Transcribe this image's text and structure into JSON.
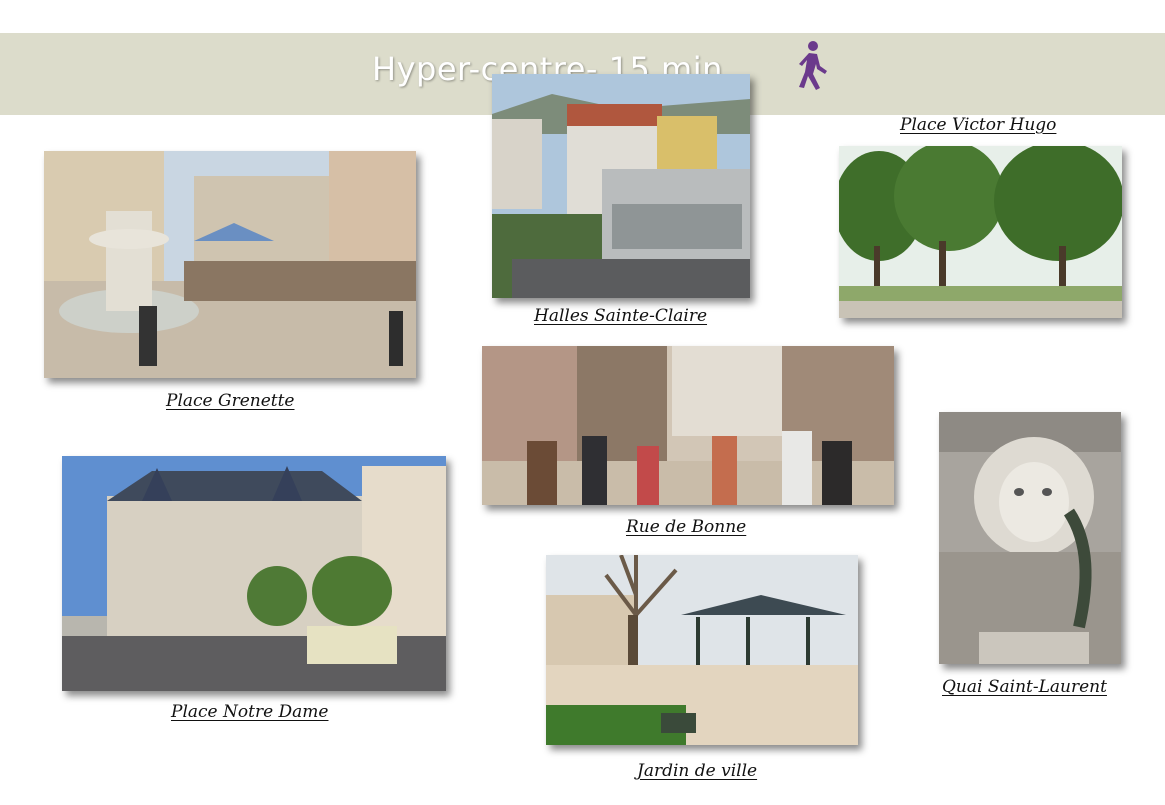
{
  "banner": {
    "title": "Hyper-centre- 15 min",
    "icon": "walking-person-icon",
    "icon_color": "#6b3a8c",
    "background": "#dcdccb"
  },
  "photos": [
    {
      "caption": "Place Grenette"
    },
    {
      "caption": "Halles Sainte-Claire"
    },
    {
      "caption": "Place Victor Hugo"
    },
    {
      "caption": "Rue de Bonne"
    },
    {
      "caption": "Place Notre Dame"
    },
    {
      "caption": "Jardin de ville"
    },
    {
      "caption": "Quai Saint-Laurent"
    }
  ]
}
